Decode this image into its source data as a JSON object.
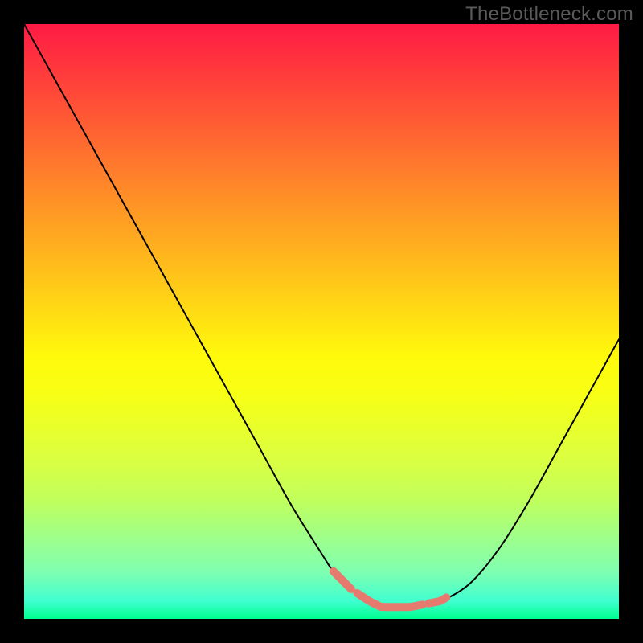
{
  "watermark": "TheBottleneck.com",
  "colors": {
    "curve": "#000000",
    "highlight": "#e67a6e",
    "page_bg": "#000000"
  },
  "chart_data": {
    "type": "line",
    "title": "",
    "xlabel": "",
    "ylabel": "",
    "xlim": [
      0,
      100
    ],
    "ylim": [
      0,
      100
    ],
    "x": [
      0,
      5,
      10,
      15,
      20,
      25,
      30,
      35,
      40,
      45,
      50,
      52,
      55,
      58,
      60,
      62,
      65,
      70,
      75,
      80,
      85,
      90,
      95,
      100
    ],
    "y": [
      100,
      91,
      82,
      73,
      64,
      55,
      46,
      37,
      28,
      19,
      11,
      8,
      5,
      3,
      2,
      2,
      2,
      3,
      6,
      12,
      20,
      29,
      38,
      47
    ],
    "highlight_ranges": [
      {
        "x_start": 52,
        "x_end": 55
      },
      {
        "x_start": 56,
        "x_end": 67
      },
      {
        "x_start": 68,
        "x_end": 71
      }
    ],
    "gradient_stops": [
      {
        "pct": 0,
        "color": "#ff1a44"
      },
      {
        "pct": 50,
        "color": "#ffe010"
      },
      {
        "pct": 100,
        "color": "#00ff90"
      }
    ]
  }
}
